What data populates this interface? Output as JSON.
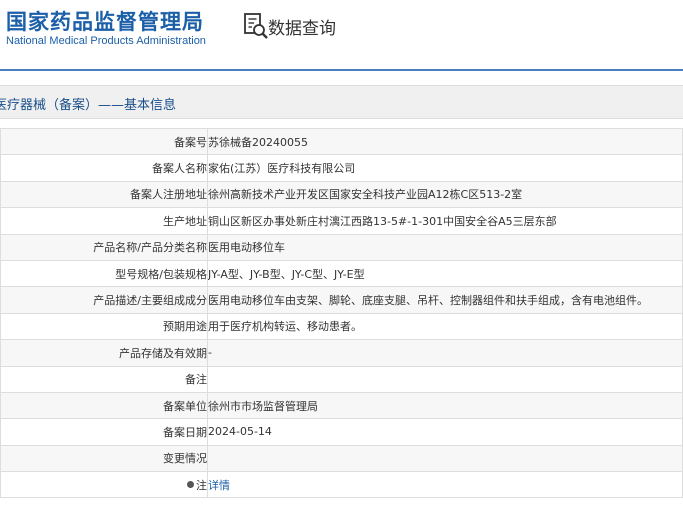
{
  "header": {
    "logo_cn": "国家药品监督管理局",
    "logo_en": "National Medical Products Administration",
    "query_title": "数据查询",
    "query_icon": "magnifier-document-icon",
    "brand_color": "#1b5fa8"
  },
  "section": {
    "title": "医疗器械（备案）——基本信息"
  },
  "rows": [
    {
      "label": "备案号",
      "value": "苏徐械备20240055"
    },
    {
      "label": "备案人名称",
      "value": "家佑(江苏）医疗科技有限公司"
    },
    {
      "label": "备案人注册地址",
      "value": "徐州高新技术产业开发区国家安全科技产业园A12栋C区513-2室"
    },
    {
      "label": "生产地址",
      "value": "铜山区新区办事处新庄村漓江西路13-5#-1-301中国安全谷A5三层东部"
    },
    {
      "label": "产品名称/产品分类名称",
      "value": "医用电动移位车"
    },
    {
      "label": "型号规格/包装规格",
      "value": "JY-A型、JY-B型、JY-C型、JY-E型"
    },
    {
      "label": "产品描述/主要组成成分",
      "value": "医用电动移位车由支架、脚轮、底座支腿、吊杆、控制器组件和扶手组成，含有电池组件。"
    },
    {
      "label": "预期用途",
      "value": "用于医疗机构转运、移动患者。"
    },
    {
      "label": "产品存储及有效期",
      "value": "-"
    },
    {
      "label": "备注",
      "value": ""
    },
    {
      "label": "备案单位",
      "value": "徐州市市场监督管理局"
    },
    {
      "label": "备案日期",
      "value": "2024-05-14"
    },
    {
      "label": "变更情况",
      "value": ""
    }
  ],
  "note_row": {
    "label": "注",
    "link_text": "详情",
    "icon": "bullet-dot-icon"
  }
}
